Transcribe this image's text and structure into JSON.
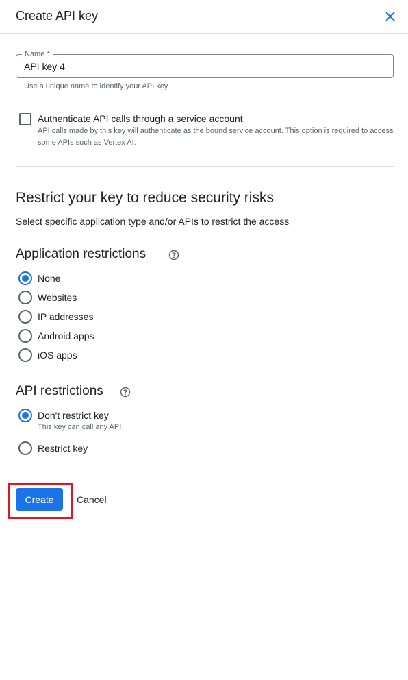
{
  "header": {
    "title": "Create API key",
    "close_icon": "close-icon"
  },
  "name_field": {
    "label": "Name *",
    "value": "API key 4",
    "helper": "Use a unique name to identify your API key"
  },
  "service_account": {
    "label": "Authenticate API calls through a service account",
    "description": "API calls made by this key will authenticate as the bound service account. This option is required to access some APIs such as Vertex AI.",
    "checked": false
  },
  "restrict": {
    "title": "Restrict your key to reduce security risks",
    "subtitle": "Select specific application type and/or APIs to restrict the access"
  },
  "application_restrictions": {
    "title": "Application restrictions",
    "options": [
      "None",
      "Websites",
      "IP addresses",
      "Android apps",
      "iOS apps"
    ],
    "selected": "None"
  },
  "api_restrictions": {
    "title": "API restrictions",
    "options": [
      {
        "label": "Don't restrict key",
        "description": "This key can call any API"
      },
      {
        "label": "Restrict key"
      }
    ],
    "selected": "Don't restrict key"
  },
  "actions": {
    "create": "Create",
    "cancel": "Cancel"
  },
  "colors": {
    "accent": "#1a73e8",
    "highlight": "#e3141f"
  }
}
